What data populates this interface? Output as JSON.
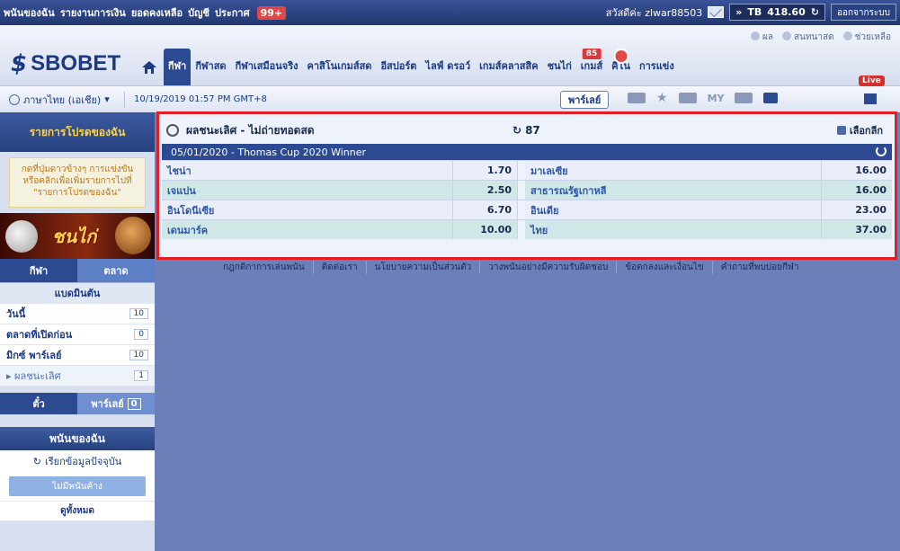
{
  "topbar": {
    "menu": [
      "พนันของฉัน",
      "รายงานการเงิน",
      "ยอดคงเหลือ",
      "บัญชี",
      "ประกาศ"
    ],
    "announce_badge": "99+",
    "welcome": "สวัสดีค่ะ zlwar88503",
    "currency": "TB",
    "balance": "418.60",
    "logout": "ออกจากระบบ"
  },
  "header": {
    "logo": "SBOBET",
    "nav": [
      "กีฬา",
      "กีฬาสด",
      "กีฬาเสมือนจริง",
      "คาสิโนเกมส์สด",
      "อีสปอร์ต",
      "ไลฟ์ ดรอว์",
      "เกมส์คลาสสิค",
      "ชนไก่",
      "เกมส์",
      "คีโน",
      "การแข่ง"
    ],
    "games_badge": "85",
    "util": [
      "ผล",
      "สนทนาสด",
      "ช่วยเหลือ"
    ]
  },
  "subbar": {
    "language": "ภาษาไทย (เอเชีย)",
    "datetime": "10/19/2019 01:57 PM GMT+8",
    "parlay": "พาร์เลย์",
    "my": "MY",
    "live": "Live"
  },
  "sidebar": {
    "favorites_title": "รายการโปรดของฉัน",
    "favorites_hint": "กดที่ปุ่มดาวข้างๆ การแข่งขัน หรือคลิกเพื่อเพิ่มรายการไปที่ \"รายการโปรดของฉัน\"",
    "promo_text": "ชนไก่",
    "tabs": [
      "กีฬา",
      "ตลาด"
    ],
    "category": "แบดมินตัน",
    "rows": [
      {
        "label": "วันนี้",
        "count": "10"
      },
      {
        "label": "ตลาดที่เปิดก่อน",
        "count": "0"
      },
      {
        "label": "มิกซ์ พาร์เลย์",
        "count": "10"
      },
      {
        "label": "ผลชนะเลิศ",
        "count": "1"
      }
    ],
    "ticket_tabs": [
      "ตั๋ว",
      "พาร์เลย์"
    ],
    "ticket_count": "0",
    "mybets_title": "พนันของฉัน",
    "refresh": "เรียกข้อมูลปัจจุบัน",
    "no_bets": "ไม่มีพนันค้าง",
    "view_all": "ดูทั้งหมด"
  },
  "panel": {
    "title": "ผลชนะเลิศ - ไม่ถ่ายทอดสด",
    "refresh_count": "87",
    "select": "เลือกลีก",
    "league": "05/01/2020 - Thomas Cup 2020 Winner",
    "rows": [
      {
        "team1": "ไชน่า",
        "odd1": "1.70",
        "team2": "มาเลเซีย",
        "odd2": "16.00"
      },
      {
        "team1": "เจแปน",
        "odd1": "2.50",
        "team2": "สาธารณรัฐเกาหลี",
        "odd2": "16.00"
      },
      {
        "team1": "อินโดนีเซีย",
        "odd1": "6.70",
        "team2": "อินเดีย",
        "odd2": "23.00"
      },
      {
        "team1": "เดนมาร์ค",
        "odd1": "10.00",
        "team2": "ไทย",
        "odd2": "37.00"
      }
    ]
  },
  "footer": [
    "กฎกติกาการเล่นพนัน",
    "ติดต่อเรา",
    "นโยบายความเป็นส่วนตัว",
    "วางพนันอย่างมีความรับผิดชอบ",
    "ข้อตกลงและเงื่อนไข",
    "คำถามที่พบบ่อยกีฬา"
  ]
}
